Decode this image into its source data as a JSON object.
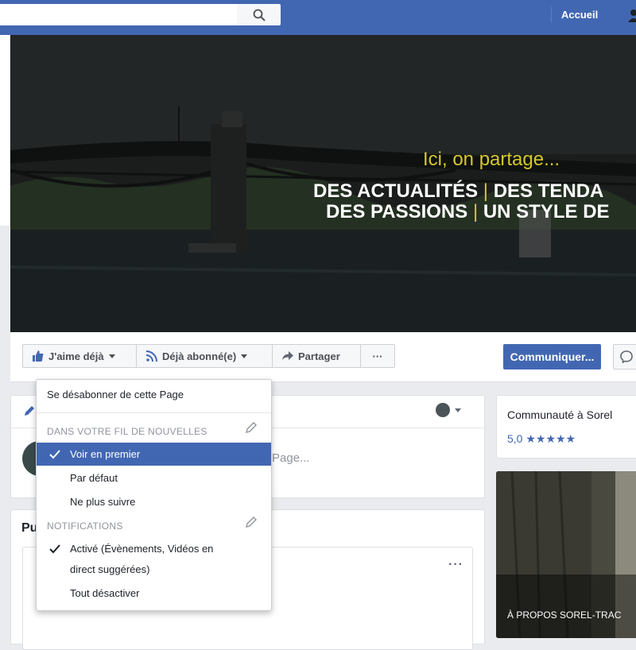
{
  "topbar": {
    "home_label": "Accueil"
  },
  "cover": {
    "tagline": "Ici, on partage...",
    "line1_a": "DES ACTUALITÉS",
    "line1_b": "DES TENDA",
    "line2_a": "DES PASSIONS",
    "line2_b": "UN STYLE DE",
    "separator": "|"
  },
  "actions": {
    "like_label": "J'aime déjà",
    "follow_label": "Déjà abonné(e)",
    "share_label": "Partager",
    "more_label": "···",
    "contact_label": "Communiquer..."
  },
  "composer": {
    "hint": "Page..."
  },
  "posts": {
    "title": "Pu",
    "more": "···"
  },
  "community": {
    "title": "Communauté à Sorel",
    "rating": "5,0 ★★★★★"
  },
  "about": {
    "label": "À PROPOS SOREL-TRAC"
  },
  "menu": {
    "unfollow_page": "Se désabonner de cette Page",
    "section_feed": "DANS VOTRE FIL DE NOUVELLES",
    "see_first": "Voir en premier",
    "default": "Par défaut",
    "unfollow": "Ne plus suivre",
    "section_notifications": "NOTIFICATIONS",
    "active_line1": "Activé (Évènements, Vidéos en",
    "active_line2": "direct suggérées)",
    "all_off": "Tout désactiver"
  },
  "colors": {
    "brand": "#4267b2",
    "cover_accent": "#d4c82a"
  }
}
